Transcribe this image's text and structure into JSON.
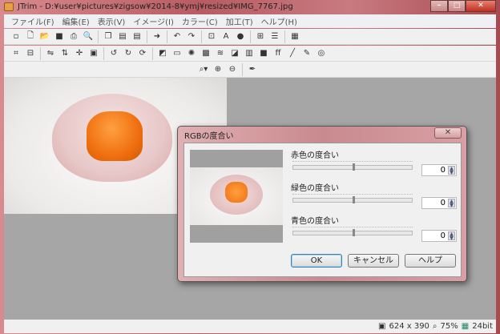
{
  "window": {
    "title": "JTrim - D:¥user¥pictures¥zigsow¥2014-8¥ymj¥resized¥IMG_7767.jpg",
    "min": "–",
    "max": "□",
    "close": "✕"
  },
  "menu": [
    "ファイル(F)",
    "編集(E)",
    "表示(V)",
    "イメージ(I)",
    "カラー(C)",
    "加工(T)",
    "ヘルプ(H)"
  ],
  "toolbar1": [
    "window-icon",
    "new-icon",
    "open-icon",
    "save-icon",
    "print-icon",
    "print-preview-icon",
    "|",
    "copy-icon",
    "paste-icon",
    "paste-new-icon",
    "|",
    "capture-icon",
    "|",
    "undo-icon",
    "redo-icon",
    "|",
    "fit-icon",
    "text-icon",
    "circle-icon",
    "|",
    "grid-icon",
    "stripe-icon",
    "|",
    "color-icon"
  ],
  "toolbar2": [
    "crop-icon",
    "resize-icon",
    "|",
    "flip-h-icon",
    "flip-v-icon",
    "rotate-icon",
    "frame-icon",
    "|",
    "rotate-left-icon",
    "rotate-right-icon",
    "rotate-free-icon",
    "|",
    "shadow-icon",
    "flat-icon",
    "sparkle-icon",
    "mosaic-icon",
    "wave-icon",
    "emboss-icon",
    "blur-icon",
    "black-icon",
    "text-ff-icon",
    "pen-icon",
    "brush-icon",
    "spiral-icon"
  ],
  "toolbar3": [
    "zoom-dropdown-icon",
    "zoom-in-icon",
    "zoom-out-icon",
    "|",
    "eyedropper-icon"
  ],
  "glyphs": {
    "window-icon": "▫",
    "new-icon": "🗋",
    "open-icon": "📂",
    "save-icon": "■",
    "print-icon": "⎙",
    "print-preview-icon": "🔍",
    "copy-icon": "❐",
    "paste-icon": "▤",
    "paste-new-icon": "▤",
    "capture-icon": "➜",
    "undo-icon": "↶",
    "redo-icon": "↷",
    "fit-icon": "⊡",
    "text-icon": "A",
    "circle-icon": "●",
    "grid-icon": "⊞",
    "stripe-icon": "☰",
    "color-icon": "▦",
    "crop-icon": "⌗",
    "resize-icon": "⊟",
    "flip-h-icon": "⇋",
    "flip-v-icon": "⇅",
    "rotate-icon": "✛",
    "frame-icon": "▣",
    "rotate-left-icon": "↺",
    "rotate-right-icon": "↻",
    "rotate-free-icon": "⟳",
    "shadow-icon": "◩",
    "flat-icon": "▭",
    "sparkle-icon": "✺",
    "mosaic-icon": "▩",
    "wave-icon": "≋",
    "emboss-icon": "◪",
    "blur-icon": "▥",
    "black-icon": "■",
    "text-ff-icon": "ff",
    "pen-icon": "╱",
    "brush-icon": "✎",
    "spiral-icon": "◎",
    "zoom-dropdown-icon": "⌕▾",
    "zoom-in-icon": "⊕",
    "zoom-out-icon": "⊖",
    "eyedropper-icon": "✒"
  },
  "status": {
    "size": "624 x 390",
    "zoom": "75%",
    "depth": "24bit"
  },
  "dialog": {
    "title": "RGBの度合い",
    "close": "✕",
    "sliders": [
      {
        "label": "赤色の度合い",
        "value": "0",
        "fraction": 0.5
      },
      {
        "label": "緑色の度合い",
        "value": "0",
        "fraction": 0.5
      },
      {
        "label": "青色の度合い",
        "value": "0",
        "fraction": 0.5
      }
    ],
    "ok": "OK",
    "cancel": "キャンセル",
    "help": "ヘルプ"
  }
}
